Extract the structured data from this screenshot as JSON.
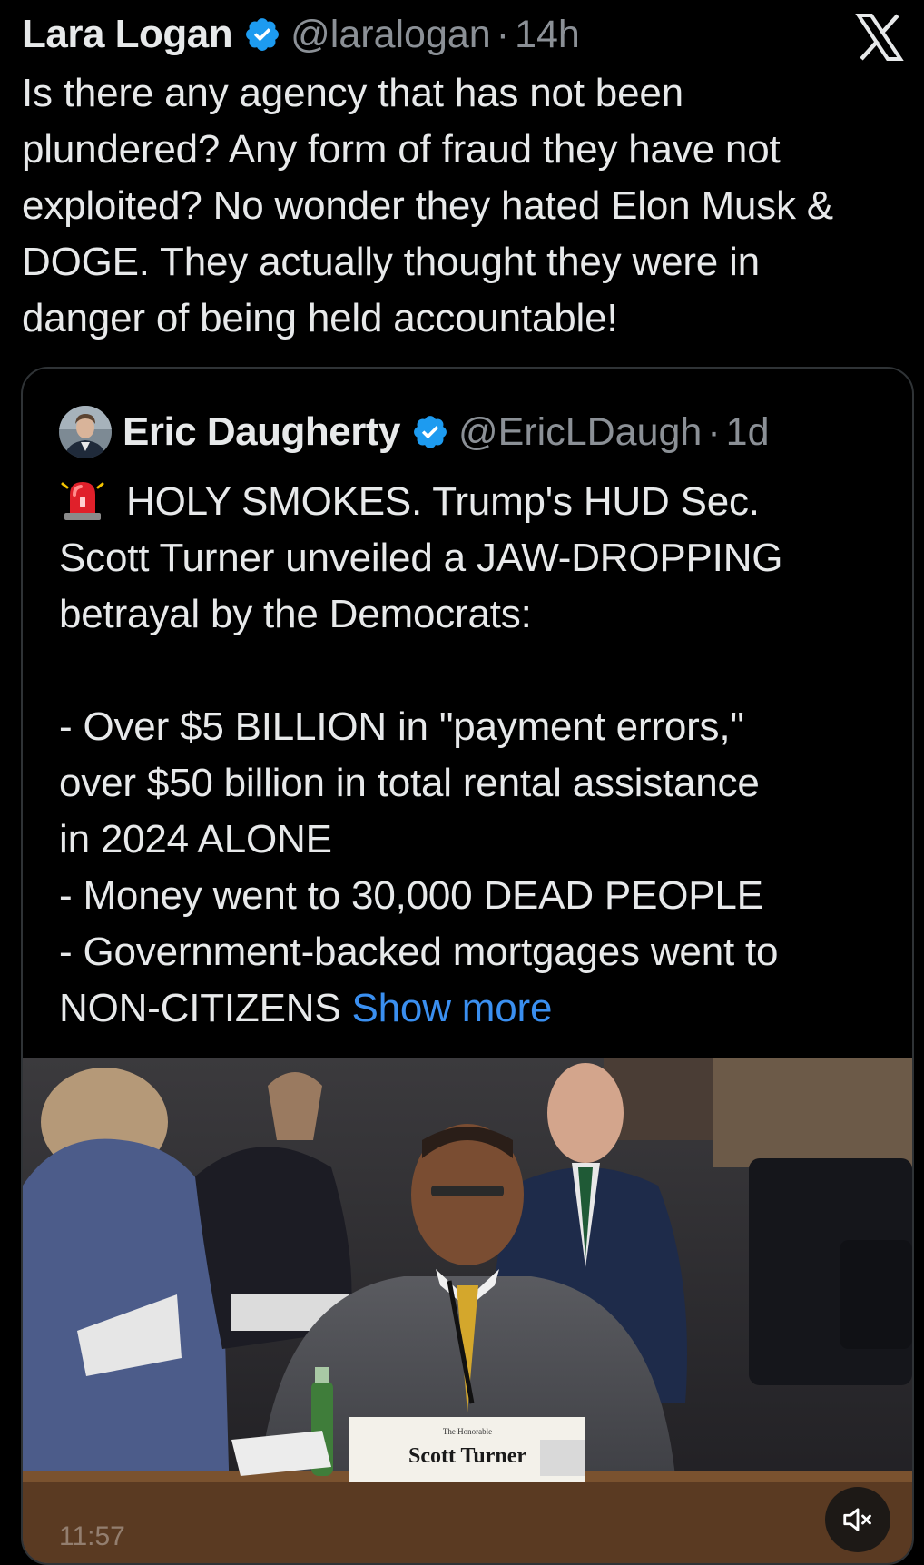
{
  "tweet": {
    "author_name": "Lara Logan",
    "handle": "@laralogan",
    "separator": "·",
    "time": "14h",
    "text": "Is there any agency that has not been\nplundered? Any form of fraud they have not\nexploited? No wonder they hated Elon Musk &\nDOGE. They actually thought they were in\ndanger of being held accountable!"
  },
  "quoted_tweet": {
    "author_name": "Eric Daugherty",
    "handle": "@EricLDaugh",
    "separator": "·",
    "time": "1d",
    "text": "HOLY SMOKES. Trump's HUD Sec.\nScott Turner unveiled a JAW-DROPPING\nbetrayal by the Democrats:\n\n- Over $5 BILLION in \"payment errors,\"\nover $50 billion in total rental assistance\nin 2024 ALONE\n- Money went to 30,000 DEAD PEOPLE\n- Government-backed mortgages went to\nNON-CITIZENS ",
    "show_more": "Show more"
  },
  "video": {
    "nameplate": "Scott Turner",
    "nameplate_small": "The Honorable",
    "time_overlay": "11:57"
  },
  "colors": {
    "background": "#000000",
    "text": "#e7e9ea",
    "secondary_text": "#8b9096",
    "verified_blue": "#1d9bf0",
    "link_blue": "#3a8ff0",
    "border": "#2f3336"
  },
  "icons": {
    "verified": "verified-badge-icon",
    "close": "x-logo-icon",
    "siren": "police-light-emoji-icon",
    "mute": "speaker-muted-icon"
  }
}
